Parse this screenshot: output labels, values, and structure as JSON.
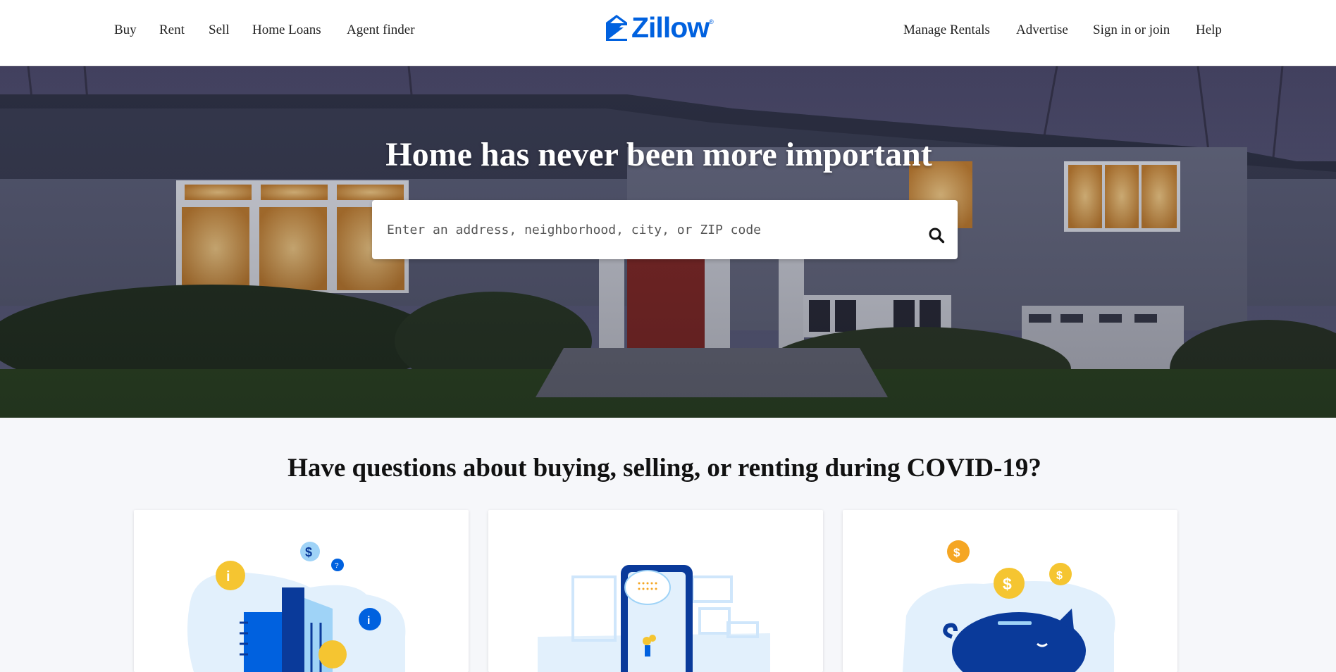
{
  "nav": {
    "left": [
      {
        "label": "Buy"
      },
      {
        "label": "Rent"
      },
      {
        "label": "Sell"
      },
      {
        "label": "Home Loans"
      },
      {
        "label": "Agent finder"
      }
    ],
    "right": [
      {
        "label": "Manage Rentals"
      },
      {
        "label": "Advertise"
      },
      {
        "label": "Sign in or join"
      },
      {
        "label": "Help"
      }
    ],
    "logo_text": "Zillow",
    "logo_mark": "®",
    "brand_color": "#0061df"
  },
  "hero": {
    "title": "Home has never been more important",
    "search": {
      "placeholder": "Enter an address, neighborhood, city, or ZIP code",
      "value": "",
      "icon": "search-icon"
    }
  },
  "covid": {
    "title": "Have questions about buying, selling, or renting during COVID-19?",
    "cards": [
      {
        "illustration": "info-document-illustration"
      },
      {
        "illustration": "phone-tour-illustration"
      },
      {
        "illustration": "piggy-bank-illustration"
      }
    ]
  },
  "colors": {
    "accent": "#0061df",
    "coin": "#f5c531",
    "dark_blue": "#0a3a9a",
    "light_blue": "#cfe6fb"
  }
}
